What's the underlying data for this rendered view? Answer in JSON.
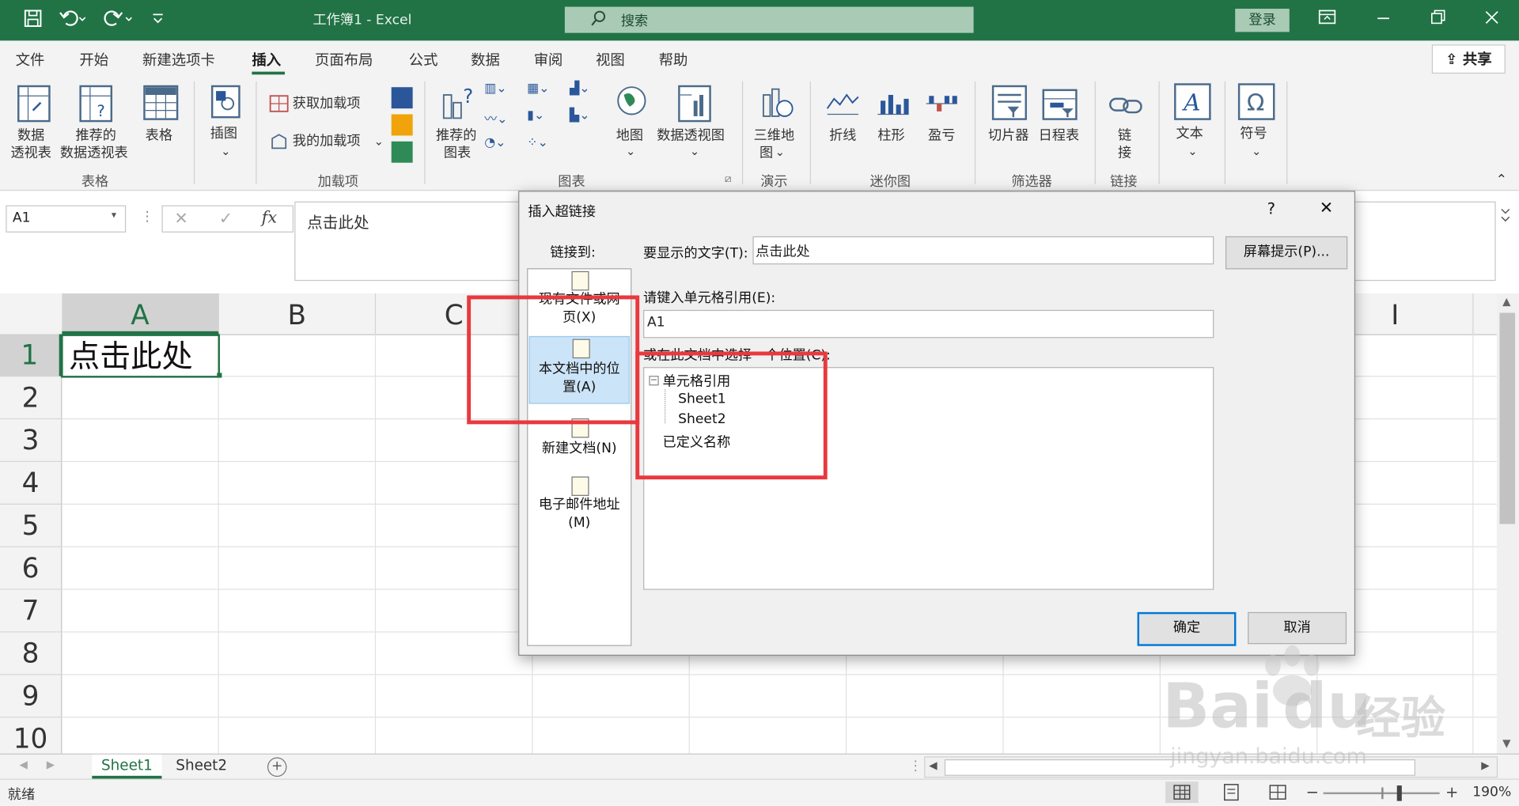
{
  "titlebar": {
    "doc_title": "工作簿1  -  Excel",
    "search_placeholder": "搜索",
    "login": "登录",
    "quick_access": [
      "save-icon",
      "undo-icon",
      "redo-icon",
      "customize-icon"
    ],
    "window_controls": [
      "ribbon-display-icon",
      "minimize-icon",
      "restore-icon",
      "close-icon"
    ]
  },
  "menu": {
    "tabs": [
      "文件",
      "开始",
      "新建选项卡",
      "插入",
      "页面布局",
      "公式",
      "数据",
      "审阅",
      "视图",
      "帮助"
    ],
    "active": "插入",
    "share": "共享"
  },
  "ribbon": {
    "groups": {
      "tables": "表格",
      "addins": "加载项",
      "charts": "图表",
      "tours": "演示",
      "sparklines": "迷你图",
      "filters": "筛选器",
      "links": "链接"
    },
    "buttons": {
      "pivot_table_1": "数据",
      "pivot_table_2": "透视表",
      "recommended_pivot_1": "推荐的",
      "recommended_pivot_2": "数据透视表",
      "table": "表格",
      "illustrations": "插图",
      "get_addins": "获取加载项",
      "my_addins": "我的加载项",
      "recommended_charts_1": "推荐的",
      "recommended_charts_2": "图表",
      "maps": "地图",
      "pivot_chart": "数据透视图",
      "map3d_1": "三维地",
      "map3d_2": "图",
      "line": "折线",
      "column": "柱形",
      "win_loss": "盈亏",
      "slicer": "切片器",
      "timeline": "日程表",
      "link_1": "链",
      "link_2": "接",
      "text": "文本",
      "symbols": "符号"
    }
  },
  "formula_bar": {
    "name_box": "A1",
    "cancel": "✕",
    "enter": "✓",
    "fx": "fx",
    "content": "点击此处"
  },
  "grid": {
    "columns": [
      "A",
      "B",
      "C",
      "I"
    ],
    "rows": [
      "1",
      "2",
      "3",
      "4",
      "5",
      "6",
      "7",
      "8",
      "9",
      "10"
    ],
    "cell_a1": "点击此处"
  },
  "sheets": {
    "tabs": [
      "Sheet1",
      "Sheet2"
    ],
    "active": "Sheet1",
    "add": "+"
  },
  "status": {
    "mode": "就绪",
    "zoom": "190%",
    "zoom_minus": "−",
    "zoom_plus": "+"
  },
  "dialog": {
    "title": "插入超链接",
    "help": "?",
    "close": "✕",
    "link_to_label": "链接到:",
    "link_options": [
      {
        "label_1": "现有文件或网",
        "label_2": "页(X)"
      },
      {
        "label_1": "本文档中的位",
        "label_2": "置(A)"
      },
      {
        "label_1": "新建文档(N)"
      },
      {
        "label_1": "电子邮件地址",
        "label_2": "(M)"
      }
    ],
    "display_text_label": "要显示的文字(T):",
    "display_text_value": "点击此处",
    "screentip_button": "屏幕提示(P)...",
    "cell_ref_label": "请键入单元格引用(E):",
    "cell_ref_value": "A1",
    "place_label": "或在此文档中选择一个位置(C):",
    "tree": {
      "root": "单元格引用",
      "children": [
        "Sheet1",
        "Sheet2"
      ],
      "defined_names": "已定义名称"
    },
    "ok": "确定",
    "cancel": "取消"
  },
  "watermark": {
    "brand": "Bai",
    "brand2": "du",
    "suffix": "经验",
    "url": "jingyan.baidu.com"
  },
  "colors": {
    "excel_green": "#217346",
    "annotation_red": "#e8393f",
    "selection_blue": "#cce4f7"
  }
}
